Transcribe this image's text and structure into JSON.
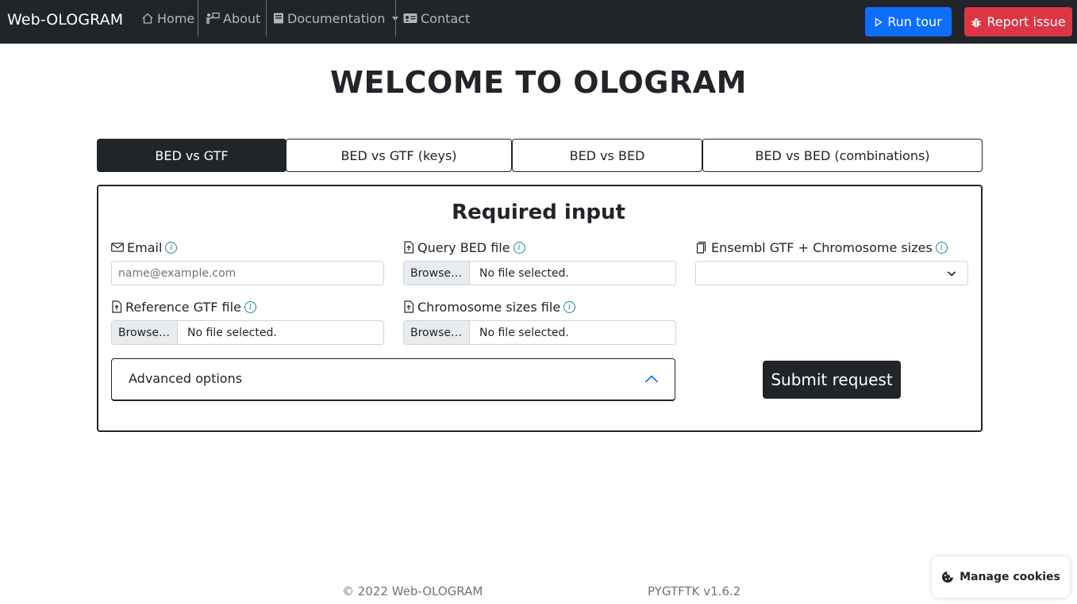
{
  "navbar": {
    "brand": "Web-OLOGRAM",
    "items": [
      {
        "label": "Home",
        "icon": "house-icon"
      },
      {
        "label": "About",
        "icon": "person-board-icon"
      },
      {
        "label": "Documentation",
        "icon": "book-icon"
      },
      {
        "label": "Contact",
        "icon": "contact-card-icon"
      }
    ],
    "run_tour_label": "Run tour",
    "report_issue_label": "Report issue",
    "colors": {
      "background": "#212529",
      "run_tour": "#0d6efd",
      "report_issue": "#dc3545"
    }
  },
  "page_title": "WELCOME TO OLOGRAM",
  "tabs": [
    {
      "label": "BED vs GTF",
      "active": true
    },
    {
      "label": "BED vs GTF (keys)",
      "active": false
    },
    {
      "label": "BED vs BED",
      "active": false
    },
    {
      "label": "BED vs BED (combinations)",
      "active": false
    }
  ],
  "form": {
    "title": "Required input",
    "email": {
      "label": "Email",
      "placeholder": "name@example.com",
      "value": ""
    },
    "query_bed": {
      "label": "Query BED file",
      "browse": "Browse…",
      "status": "No file selected."
    },
    "ensembl": {
      "label": "Ensembl GTF + Chromosome sizes",
      "selected": ""
    },
    "reference_gtf": {
      "label": "Reference GTF file",
      "browse": "Browse…",
      "status": "No file selected."
    },
    "chrom_sizes": {
      "label": "Chromosome sizes file",
      "browse": "Browse…",
      "status": "No file selected."
    },
    "advanced_label": "Advanced options",
    "submit_label": "Submit request"
  },
  "footer": {
    "copyright": "© 2022 Web-OLOGRAM",
    "version": "PYGTFTK v1.6.2"
  },
  "cookies": {
    "label": "Manage cookies"
  }
}
